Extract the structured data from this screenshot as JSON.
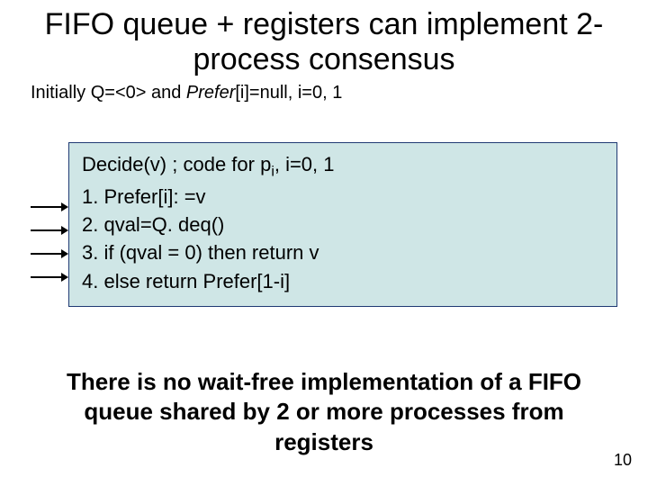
{
  "title": "FIFO queue + registers can implement 2-process consensus",
  "initial": {
    "pre": "Initially Q=",
    "qval": "<0>",
    "mid": " and ",
    "prefer": "Prefer",
    "post": "[i]=null, i=0, 1"
  },
  "code": {
    "header_pre": "Decide(v)  ; code for p",
    "header_sub": "i",
    "header_post": ", i=0, 1",
    "lines": [
      "1.  Prefer[i]: =v",
      "2.  qval=Q. deq()",
      "3.  if (qval = 0) then return v",
      "4.  else  return Prefer[1-i]"
    ]
  },
  "conclusion": "There is no wait-free implementation of a FIFO queue shared by 2 or more processes from registers",
  "page_number": "10"
}
